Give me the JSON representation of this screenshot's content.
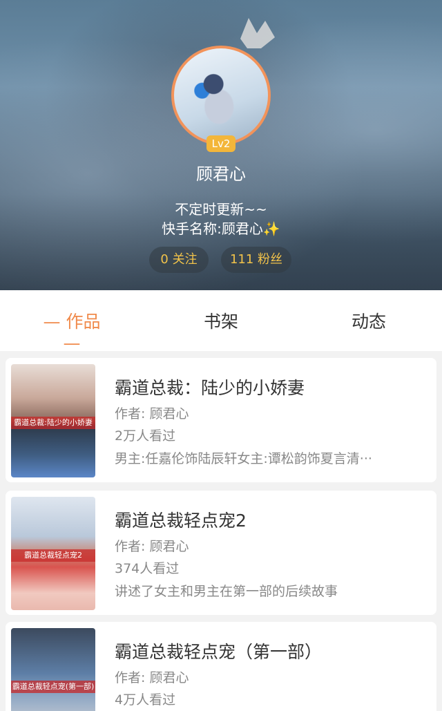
{
  "profile": {
    "level": "Lv2",
    "username": "顾君心",
    "bio_line1": "不定时更新~~",
    "bio_line2": "快手名称:顾君心",
    "bio_emoji": "✨",
    "following": "0 关注",
    "fans": "111 粉丝"
  },
  "tabs": {
    "works": "— 作品 —",
    "shelf": "书架",
    "feed": "动态"
  },
  "books": [
    {
      "title": "霸道总裁：陆少的小娇妻",
      "author": "作者: 顾君心",
      "views": "2万人看过",
      "desc": "男主:任嘉伦饰陆辰轩女主:谭松韵饰夏言清···",
      "cover_tag": "霸道总裁:陆少的小娇妻"
    },
    {
      "title": "霸道总裁轻点宠2",
      "author": "作者: 顾君心",
      "views": "374人看过",
      "desc": "讲述了女主和男主在第一部的后续故事",
      "cover_tag": "霸道总裁轻点宠2"
    },
    {
      "title": "霸道总裁轻点宠（第一部）",
      "author": "作者: 顾君心",
      "views": "4万人看过",
      "cover_tag": "霸道总裁轻点宠(第一部)"
    }
  ],
  "colors": {
    "accent": "#f08a4b",
    "badge": "#f3b63a",
    "stat_text": "#f2c34a"
  }
}
